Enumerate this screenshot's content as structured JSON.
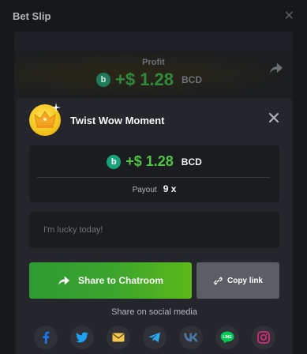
{
  "background": {
    "title": "Bet Slip",
    "profit_label": "Profit",
    "profit_amount": "+$ 1.28",
    "profit_currency": "BCD",
    "coin_glyph": "b"
  },
  "modal": {
    "title": "Twist Wow Moment",
    "amount": "+$ 1.28",
    "currency": "BCD",
    "coin_glyph": "b",
    "payout_label": "Payout",
    "payout_value": "9 x",
    "message_placeholder": "I'm lucky today!",
    "share_button_label": "Share to Chatroom",
    "copy_button_label": "Copy link",
    "social_label": "Share on social media",
    "social": [
      {
        "name": "facebook-icon",
        "color": "#1877f2"
      },
      {
        "name": "twitter-icon",
        "color": "#1da1f2"
      },
      {
        "name": "email-icon",
        "color": "#f2c94c"
      },
      {
        "name": "telegram-icon",
        "color": "#2aabee"
      },
      {
        "name": "vk-icon",
        "color": "#4c75a3"
      },
      {
        "name": "line-icon",
        "color": "#06c755"
      },
      {
        "name": "instagram-icon",
        "color": "#d62976"
      }
    ]
  },
  "colors": {
    "accent_green": "#4fc742",
    "modal_bg": "#24262b",
    "field_bg": "#1b1c20"
  }
}
